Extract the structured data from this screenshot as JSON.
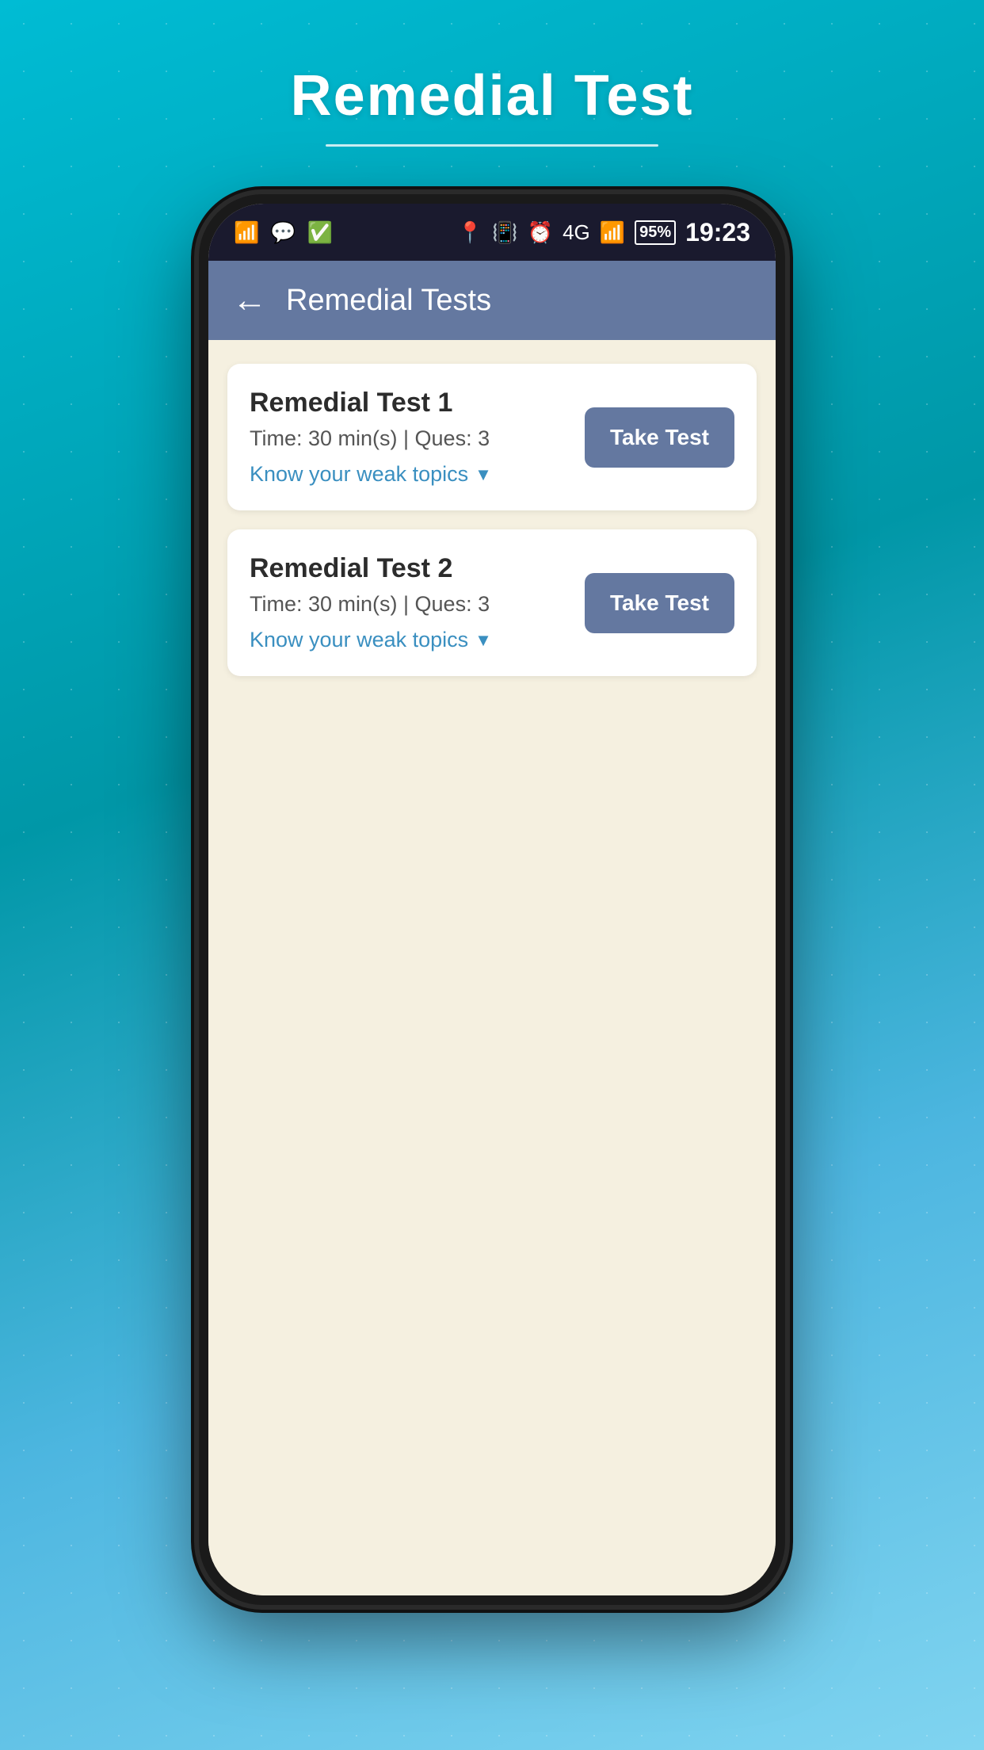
{
  "page": {
    "title": "Remedial Test",
    "title_underline": true
  },
  "status_bar": {
    "time": "19:23",
    "battery_percent": "95%",
    "signal": "4G",
    "icons": [
      "wifi",
      "notification",
      "checkmark",
      "location",
      "vibrate",
      "alarm",
      "signal",
      "battery"
    ]
  },
  "app_header": {
    "back_label": "←",
    "title": "Remedial Tests"
  },
  "tests": [
    {
      "id": 1,
      "name": "Remedial Test 1",
      "time": "30 min(s)",
      "questions": "3",
      "meta": "Time: 30 min(s) | Ques: 3",
      "weak_topics_label": "Know your weak topics",
      "take_test_label": "Take Test"
    },
    {
      "id": 2,
      "name": "Remedial Test 2",
      "time": "30 min(s)",
      "questions": "3",
      "meta": "Time: 30 min(s) | Ques: 3",
      "weak_topics_label": "Know your weak topics",
      "take_test_label": "Take Test"
    }
  ],
  "colors": {
    "header_bg": "#6478a0",
    "button_bg": "#6478a0",
    "link_color": "#3a8fc0",
    "card_bg": "#ffffff",
    "content_bg": "#f5f0e0",
    "status_bg": "#1a1a2e"
  }
}
